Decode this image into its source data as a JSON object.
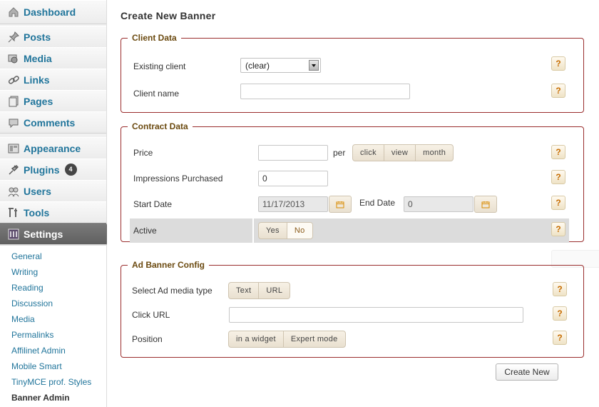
{
  "sidebar": {
    "dashboard": {
      "label": "Dashboard",
      "icon": "dashboard-icon"
    },
    "items": [
      {
        "label": "Posts",
        "icon": "pin-icon"
      },
      {
        "label": "Media",
        "icon": "media-icon"
      },
      {
        "label": "Links",
        "icon": "link-icon"
      },
      {
        "label": "Pages",
        "icon": "pages-icon"
      },
      {
        "label": "Comments",
        "icon": "comments-icon"
      }
    ],
    "items2": [
      {
        "label": "Appearance",
        "icon": "appearance-icon"
      },
      {
        "label": "Plugins",
        "icon": "plugin-icon",
        "badge": "4"
      },
      {
        "label": "Users",
        "icon": "users-icon"
      },
      {
        "label": "Tools",
        "icon": "tools-icon"
      }
    ],
    "settings": {
      "label": "Settings",
      "icon": "settings-icon"
    },
    "submenu": [
      "General",
      "Writing",
      "Reading",
      "Discussion",
      "Media",
      "Permalinks",
      "Affilinet Admin",
      "Mobile Smart",
      "TinyMCE prof. Styles",
      "Banner Admin"
    ]
  },
  "page": {
    "title": "Create New Banner"
  },
  "client": {
    "legend": "Client Data",
    "existing_label": "Existing client",
    "existing_value": "(clear)",
    "name_label": "Client name",
    "name_value": ""
  },
  "contract": {
    "legend": "Contract Data",
    "price_label": "Price",
    "price_value": "",
    "per_label": "per",
    "per_options": [
      "click",
      "view",
      "month"
    ],
    "impressions_label": "Impressions Purchased",
    "impressions_value": "0",
    "start_label": "Start Date",
    "start_value": "11/17/2013",
    "end_label": "End Date",
    "end_value": "0",
    "active_label": "Active",
    "active_options": [
      "Yes",
      "No"
    ],
    "active_selected": "No"
  },
  "adbanner": {
    "legend": "Ad Banner Config",
    "media_label": "Select Ad media type",
    "media_options": [
      "Text",
      "URL"
    ],
    "url_label": "Click URL",
    "url_value": "",
    "position_label": "Position",
    "position_options": [
      "in a widget",
      "Expert mode"
    ]
  },
  "help_symbol": "?",
  "submit_label": "Create New",
  "colors": {
    "link": "#21759b",
    "legend": "#6b4a10",
    "fieldset_border": "#9a2d2d",
    "help": "#c66c00"
  }
}
